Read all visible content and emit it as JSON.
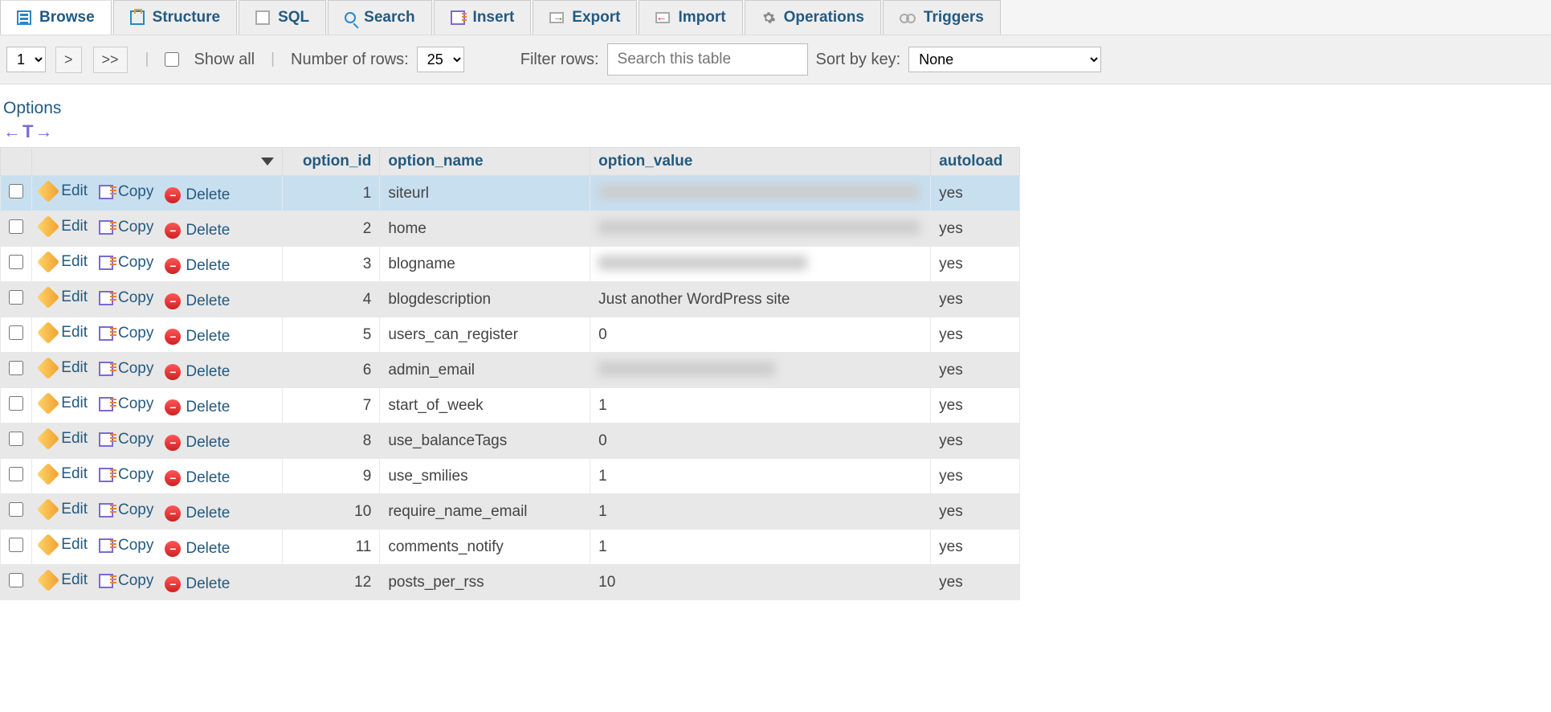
{
  "tabs": [
    {
      "label": "Browse",
      "active": true
    },
    {
      "label": "Structure"
    },
    {
      "label": "SQL"
    },
    {
      "label": "Search"
    },
    {
      "label": "Insert"
    },
    {
      "label": "Export"
    },
    {
      "label": "Import"
    },
    {
      "label": "Operations"
    },
    {
      "label": "Triggers"
    }
  ],
  "toolbar": {
    "page_select": "1",
    "next": ">",
    "last": ">>",
    "show_all": "Show all",
    "num_rows_label": "Number of rows:",
    "num_rows_value": "25",
    "filter_label": "Filter rows:",
    "filter_placeholder": "Search this table",
    "sort_label": "Sort by key:",
    "sort_value": "None"
  },
  "options_label": "Options",
  "headers": {
    "id": "option_id",
    "name": "option_name",
    "value": "option_value",
    "autoload": "autoload"
  },
  "actions": {
    "edit": "Edit",
    "copy": "Copy",
    "del": "Delete"
  },
  "rows": [
    {
      "id": "1",
      "name": "siteurl",
      "value": "",
      "blur": "w1",
      "autoload": "yes",
      "hl": true
    },
    {
      "id": "2",
      "name": "home",
      "value": "",
      "blur": "w1",
      "autoload": "yes"
    },
    {
      "id": "3",
      "name": "blogname",
      "value": "",
      "blur": "w2",
      "autoload": "yes"
    },
    {
      "id": "4",
      "name": "blogdescription",
      "value": "Just another WordPress site",
      "autoload": "yes"
    },
    {
      "id": "5",
      "name": "users_can_register",
      "value": "0",
      "autoload": "yes"
    },
    {
      "id": "6",
      "name": "admin_email",
      "value": "",
      "blur": "w3",
      "autoload": "yes"
    },
    {
      "id": "7",
      "name": "start_of_week",
      "value": "1",
      "autoload": "yes"
    },
    {
      "id": "8",
      "name": "use_balanceTags",
      "value": "0",
      "autoload": "yes"
    },
    {
      "id": "9",
      "name": "use_smilies",
      "value": "1",
      "autoload": "yes"
    },
    {
      "id": "10",
      "name": "require_name_email",
      "value": "1",
      "autoload": "yes"
    },
    {
      "id": "11",
      "name": "comments_notify",
      "value": "1",
      "autoload": "yes"
    },
    {
      "id": "12",
      "name": "posts_per_rss",
      "value": "10",
      "autoload": "yes"
    }
  ]
}
